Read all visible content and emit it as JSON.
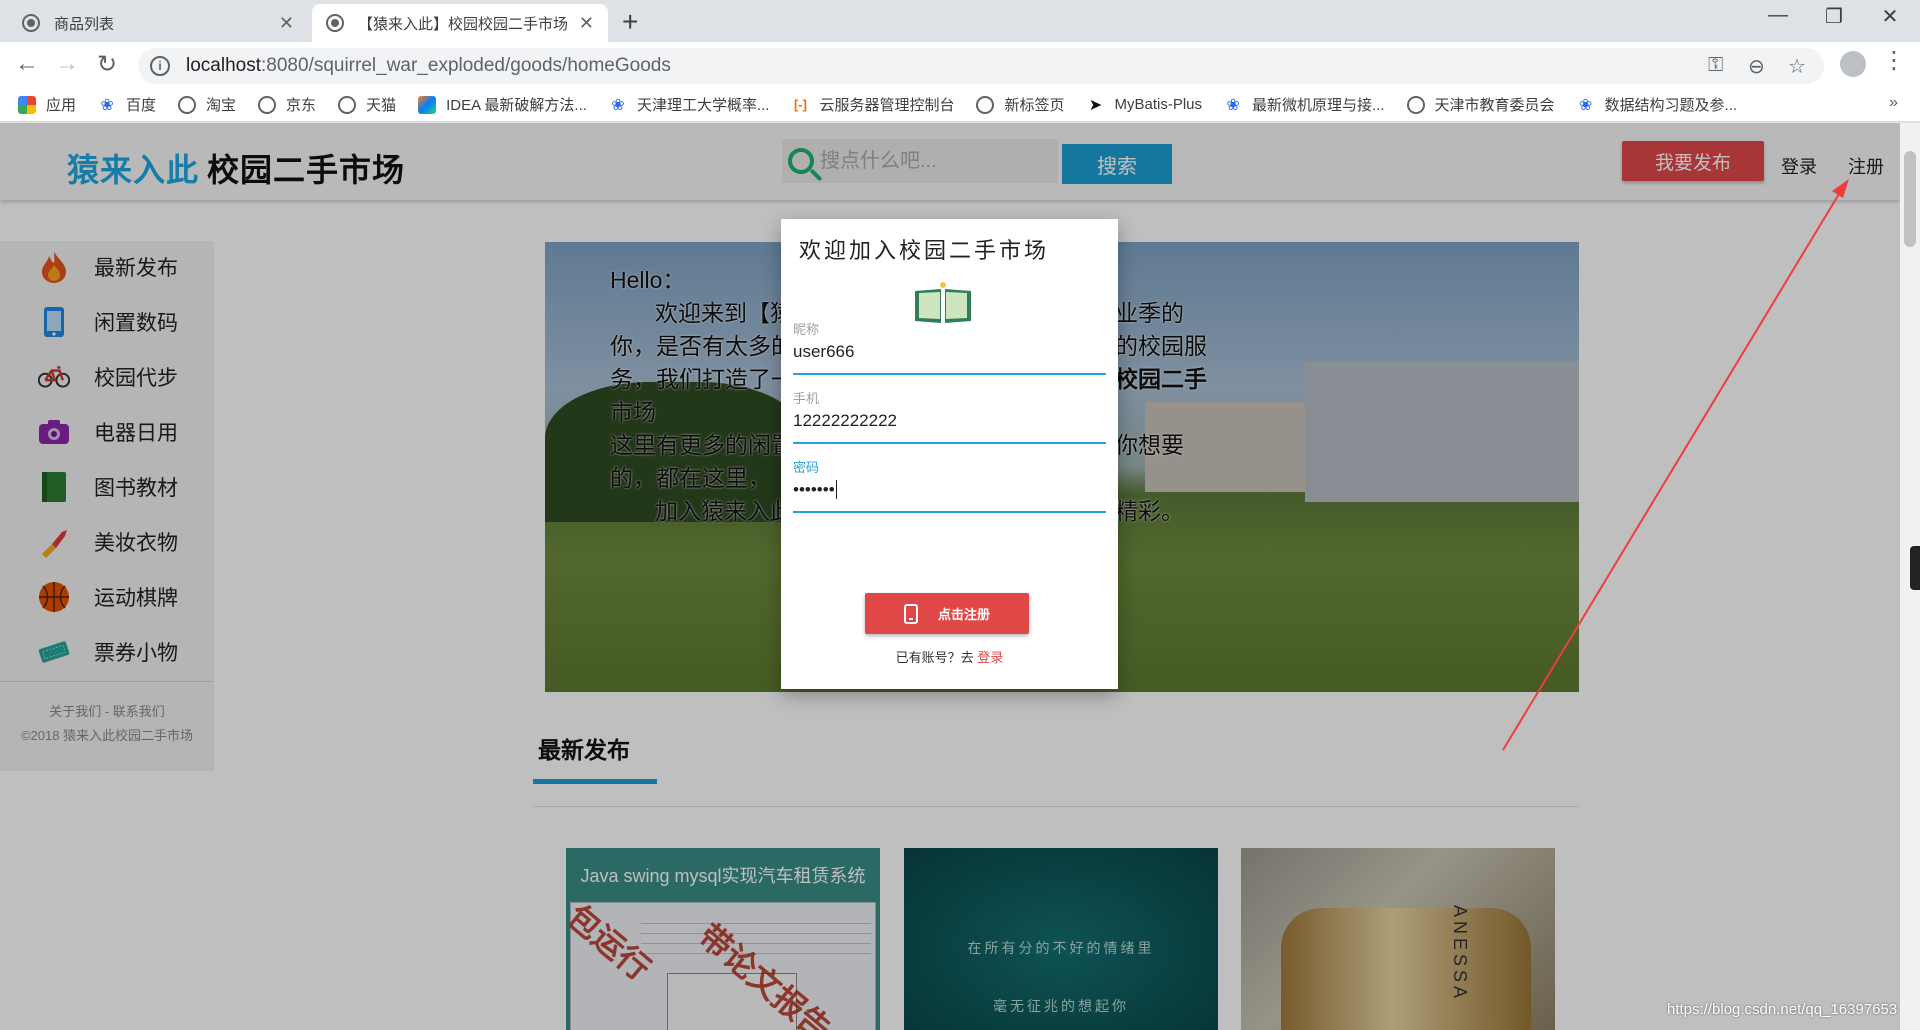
{
  "browser": {
    "tabs": [
      {
        "title": "商品列表",
        "active": false
      },
      {
        "title": "【猿来入此】校园校园二手市场",
        "active": true
      }
    ],
    "new_tab": "+",
    "window_controls": {
      "minimize": "—",
      "restore": "❐",
      "close": "✕"
    },
    "url_host": "localhost",
    "url_path": ":8080/squirrel_war_exploded/goods/homeGoods",
    "bookmarks": [
      {
        "label": "应用",
        "icon": "apps-grid-icon"
      },
      {
        "label": "百度",
        "icon": "paw-icon"
      },
      {
        "label": "淘宝",
        "icon": "globe-icon"
      },
      {
        "label": "京东",
        "icon": "globe-icon"
      },
      {
        "label": "天猫",
        "icon": "globe-icon"
      },
      {
        "label": "IDEA 最新破解方法...",
        "icon": "idea-icon"
      },
      {
        "label": "天津理工大学概率...",
        "icon": "paw-icon"
      },
      {
        "label": "云服务器管理控制台",
        "icon": "cloud-icon"
      },
      {
        "label": "新标签页",
        "icon": "globe-icon"
      },
      {
        "label": "MyBatis-Plus",
        "icon": "bird-icon"
      },
      {
        "label": "最新微机原理与接...",
        "icon": "paw-icon"
      },
      {
        "label": "天津市教育委员会",
        "icon": "globe-icon"
      },
      {
        "label": "数据结构习题及参...",
        "icon": "paw-icon"
      }
    ],
    "bookmarks_more": "»"
  },
  "header": {
    "brand": "猿来入此",
    "subtitle": "校园二手市场",
    "search_placeholder": "搜点什么吧...",
    "search_button": "搜索",
    "publish_button": "我要发布",
    "login": "登录",
    "register": "注册"
  },
  "sidebar": {
    "items": [
      {
        "label": "最新发布",
        "icon": "flame-icon"
      },
      {
        "label": "闲置数码",
        "icon": "phone-icon"
      },
      {
        "label": "校园代步",
        "icon": "bicycle-icon"
      },
      {
        "label": "电器日用",
        "icon": "camera-icon"
      },
      {
        "label": "图书教材",
        "icon": "book-icon"
      },
      {
        "label": "美妆衣物",
        "icon": "lipstick-icon"
      },
      {
        "label": "运动棋牌",
        "icon": "basketball-icon"
      },
      {
        "label": "票券小物",
        "icon": "ticket-icon"
      }
    ],
    "footer_links": "关于我们 - 联系我们",
    "copyright": "©2018 猿来入此校园二手市场"
  },
  "banner": {
    "line1": "Hello：",
    "line2": "欢迎来到【猿",
    "line2b": "业季的",
    "line3": "你，是否有太多的",
    "line3b": "的校园服",
    "line4": "务，我们打造了一",
    "line4b": "校园二手",
    "line5": "市场",
    "line6": "这里有更多的闲置",
    "line6b": "你想要",
    "line7": "的，都在这里，",
    "line8": "加入猿来入此",
    "line8b": "精彩。"
  },
  "section": {
    "title": "最新发布"
  },
  "cards": [
    {
      "caption": "Java swing mysql实现汽车租赁系统",
      "stamp1": "包运行",
      "stamp2": "带论文报告"
    },
    {
      "poem1": "在所有分的不好的情绪里",
      "poem2": "毫无征兆的想起你"
    },
    {
      "brand_text": "ANESSA"
    }
  ],
  "modal": {
    "title": "欢迎加入校园二手市场",
    "nickname_label": "昵称",
    "nickname_value": "user666",
    "phone_label": "手机",
    "phone_value": "12222222222",
    "password_label": "密码",
    "password_value": "•••••••",
    "submit_button": "点击注册",
    "login_prompt": "已有账号？去",
    "login_link": "登录"
  },
  "watermark": "https://blog.csdn.net/qq_16397653",
  "colors": {
    "brand_blue": "#1ea7e0",
    "accent_red": "#e04848",
    "search_green": "#1bb36a",
    "button_blue": "#1d9fd3"
  }
}
